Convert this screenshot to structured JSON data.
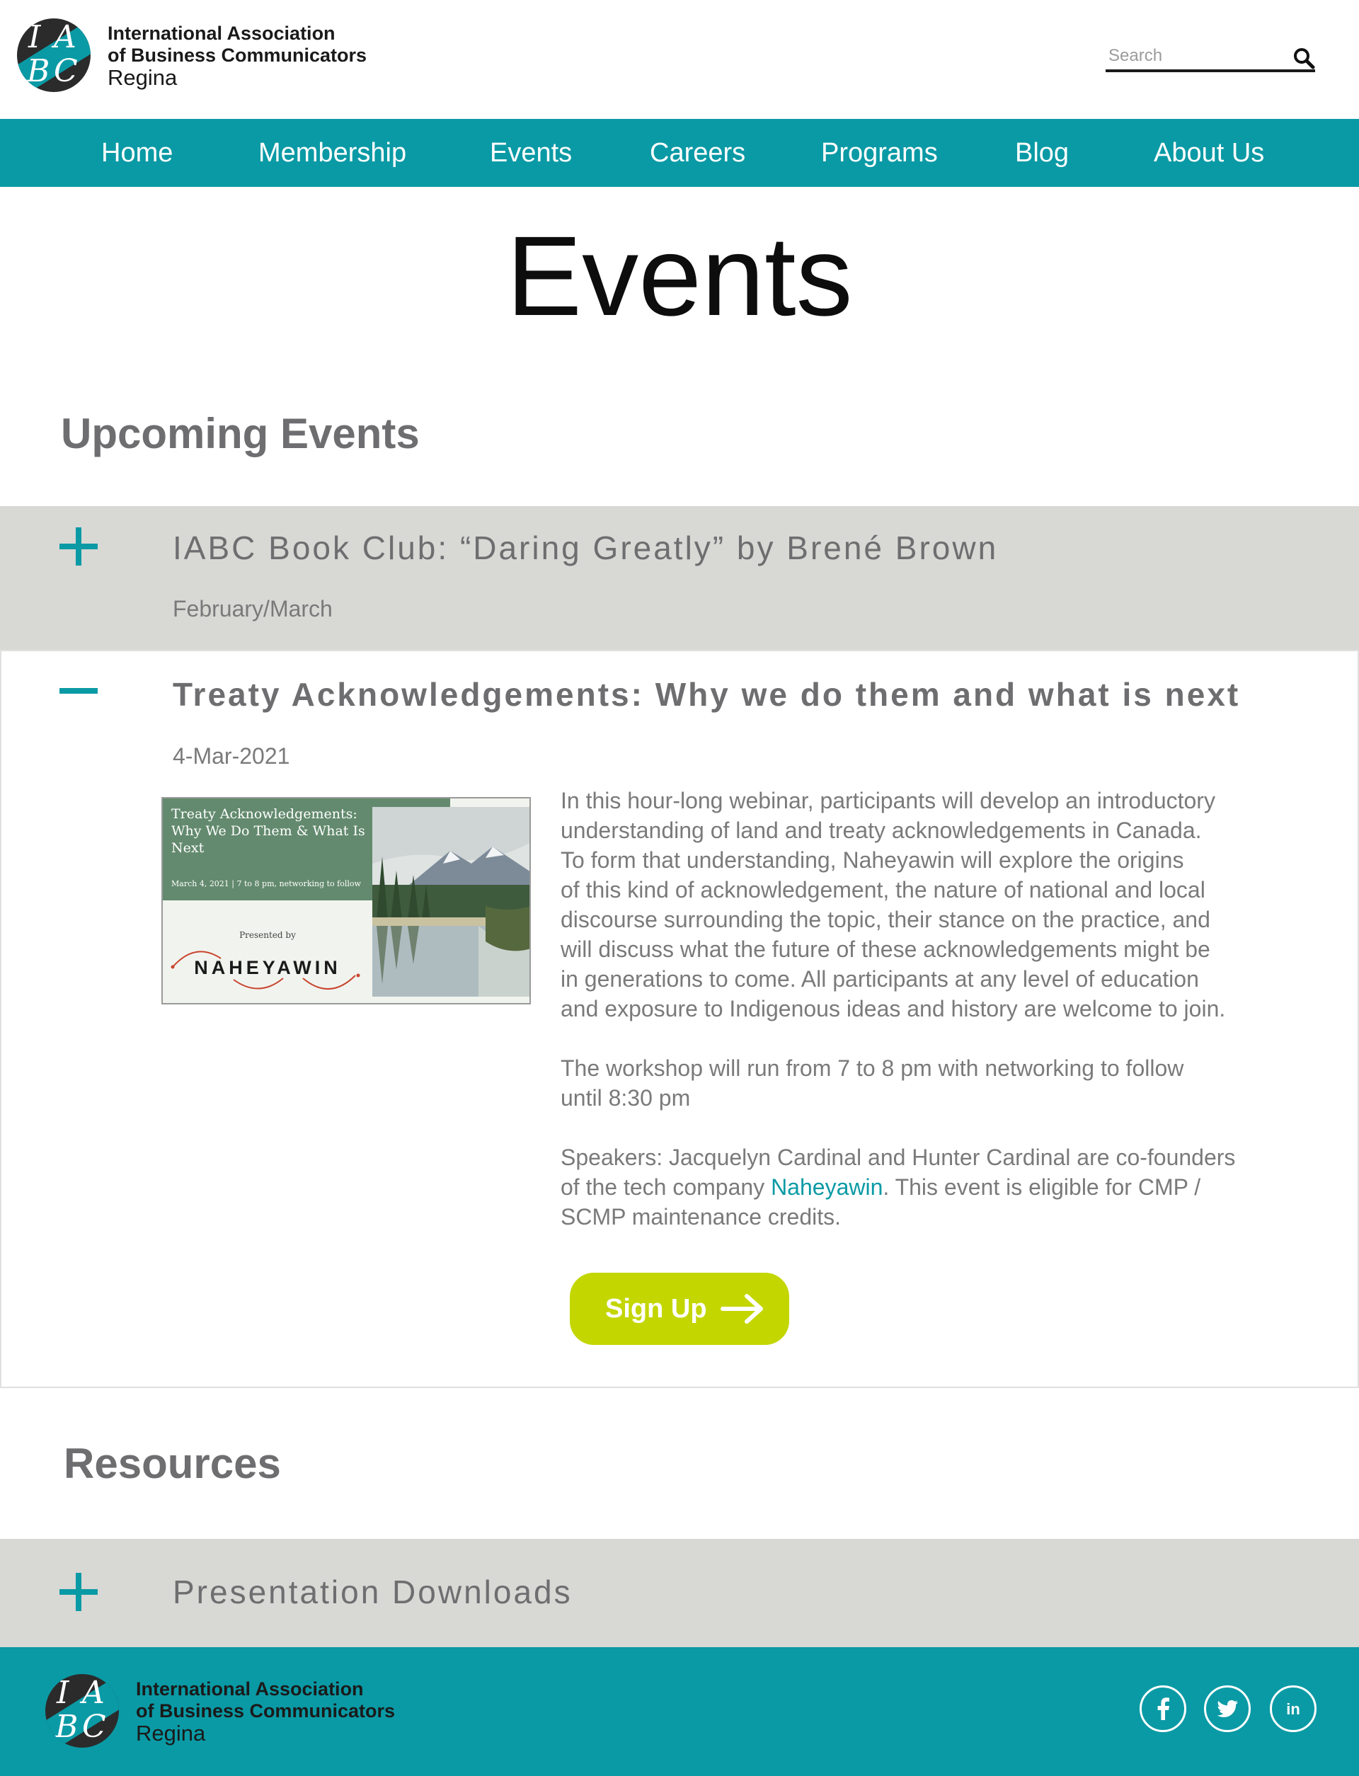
{
  "header": {
    "org_line1": "International Association",
    "org_line2": "of Business Communicators",
    "org_line3": "Regina",
    "search_placeholder": "Search"
  },
  "nav": {
    "items": [
      "Home",
      "Membership",
      "Events",
      "Careers",
      "Programs",
      "Blog",
      "About Us"
    ]
  },
  "page": {
    "title": "Events",
    "upcoming_heading": "Upcoming Events",
    "resources_heading": "Resources"
  },
  "events": [
    {
      "title": "IABC Book Club: “Daring Greatly” by Brené Brown",
      "date": "February/March",
      "expanded": false
    },
    {
      "title": "Treaty Acknowledgements: Why we do them and what is next",
      "date": "4-Mar-2021",
      "expanded": true,
      "image": {
        "title": "Treaty Acknowledgements: Why We Do Them & What Is Next",
        "date_line": "March 4, 2021 | 7 to 8 pm, networking to follow",
        "presented_by": "Presented by",
        "brand": "NAHEYAWIN"
      },
      "paragraph1": "In this hour-long webinar, participants will develop an introductory\nunderstanding of land and treaty acknowledgements in Canada.\nTo form that understanding, Naheyawin will explore the origins\nof this kind of acknowledgement, the nature of national and local\n discourse surrounding the topic, their stance on the practice, and\nwill discuss what the future of these acknowledgements might be\n in generations to come. All participants at any level of education\nand exposure to Indigenous ideas and history are welcome to join.",
      "paragraph2": "The workshop will run from 7 to 8 pm with networking to follow\n until 8:30 pm",
      "speakers_before": "Speakers: Jacquelyn Cardinal and Hunter Cardinal are co-founders\nof the tech company ",
      "speakers_link": "Naheyawin",
      "speakers_after": ". This event is eligible for CMP /\nSCMP maintenance credits.",
      "signup_label": "Sign Up"
    }
  ],
  "resources": [
    {
      "title": "Presentation Downloads",
      "expanded": false
    }
  ],
  "colors": {
    "teal": "#0a9aa5",
    "lime": "#c3d600",
    "grey_panel": "#d8d8d5",
    "heading_grey": "#6e6e70"
  },
  "icons": [
    "search-icon",
    "plus-icon",
    "minus-icon",
    "arrow-right-icon",
    "facebook-icon",
    "twitter-icon",
    "linkedin-icon"
  ]
}
